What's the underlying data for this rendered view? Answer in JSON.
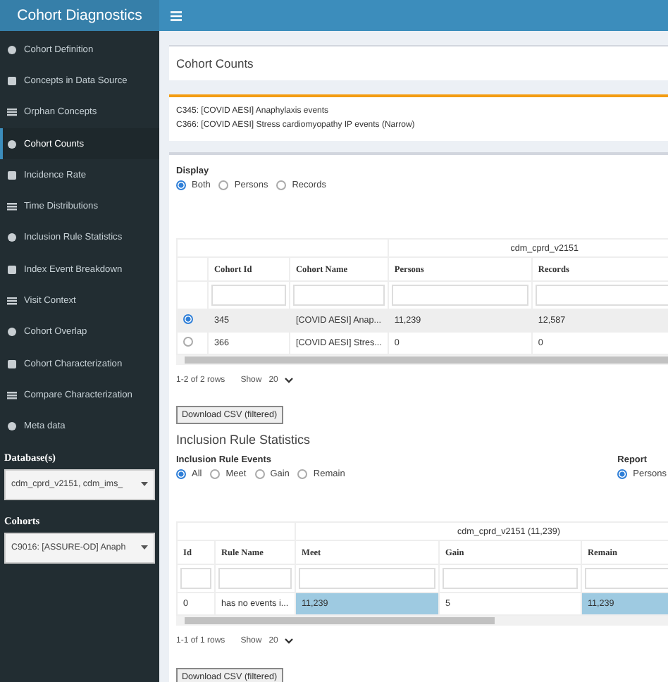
{
  "app_title": "Cohort Diagnostics",
  "sidebar": {
    "items": [
      {
        "label": "Cohort Definition",
        "selected": false
      },
      {
        "label": "Concepts in Data Source",
        "selected": false
      },
      {
        "label": "Orphan Concepts",
        "selected": false
      },
      {
        "label": "Cohort Counts",
        "selected": true
      },
      {
        "label": "Incidence Rate",
        "selected": false
      },
      {
        "label": "Time Distributions",
        "selected": false
      },
      {
        "label": "Inclusion Rule Statistics",
        "selected": false
      },
      {
        "label": "Index Event Breakdown",
        "selected": false
      },
      {
        "label": "Visit Context",
        "selected": false
      },
      {
        "label": "Cohort Overlap",
        "selected": false
      },
      {
        "label": "Cohort Characterization",
        "selected": false
      },
      {
        "label": "Compare Characterization",
        "selected": false
      },
      {
        "label": "Meta data",
        "selected": false
      }
    ],
    "filters": [
      {
        "label": "Database(s)",
        "value": "cdm_cprd_v2151, cdm_ims_"
      },
      {
        "label": "Cohorts",
        "value": "C9016: [ASSURE-OD] Anaph"
      }
    ]
  },
  "page_title": "Cohort Counts",
  "cohort_notes": [
    "C345: [COVID AESI] Anaphylaxis events",
    "C366: [COVID AESI] Stress cardiomyopathy IP events (Narrow)"
  ],
  "display": {
    "label": "Display",
    "options": [
      {
        "label": "Both",
        "selected": true
      },
      {
        "label": "Persons",
        "selected": false
      },
      {
        "label": "Records",
        "selected": false
      }
    ]
  },
  "counts_table": {
    "group": "cdm_cprd_v2151",
    "columns": [
      "Cohort Id",
      "Cohort Name",
      "Persons",
      "Records"
    ],
    "rows": [
      {
        "selected": true,
        "cells": [
          "345",
          "[COVID AESI] Anap...",
          "11,239",
          "12,587"
        ]
      },
      {
        "selected": false,
        "cells": [
          "366",
          "[COVID AESI] Stres...",
          "0",
          "0"
        ]
      }
    ],
    "footer": "1-2 of 2 rows",
    "show_label": "Show",
    "page_size": "20",
    "download": "Download CSV (filtered)"
  },
  "inclusion": {
    "title": "Inclusion Rule Statistics",
    "events_label": "Inclusion Rule Events",
    "events": [
      {
        "label": "All",
        "selected": true
      },
      {
        "label": "Meet",
        "selected": false
      },
      {
        "label": "Gain",
        "selected": false
      },
      {
        "label": "Remain",
        "selected": false
      }
    ],
    "report_label": "Report",
    "report": [
      {
        "label": "Persons",
        "selected": true
      }
    ],
    "table": {
      "group": "cdm_cprd_v2151 (11,239)",
      "columns": [
        "Id",
        "Rule Name",
        "Meet",
        "Gain",
        "Remain"
      ],
      "rows": [
        {
          "cells": [
            {
              "text": "0",
              "highlight": false
            },
            {
              "text": "has no events i...",
              "highlight": false
            },
            {
              "text": "11,239",
              "highlight": true
            },
            {
              "text": "5",
              "highlight": false
            },
            {
              "text": "11,239",
              "highlight": true
            }
          ]
        }
      ],
      "footer": "1-1 of 1 rows",
      "show_label": "Show",
      "page_size": "20",
      "download": "Download CSV (filtered)"
    }
  }
}
